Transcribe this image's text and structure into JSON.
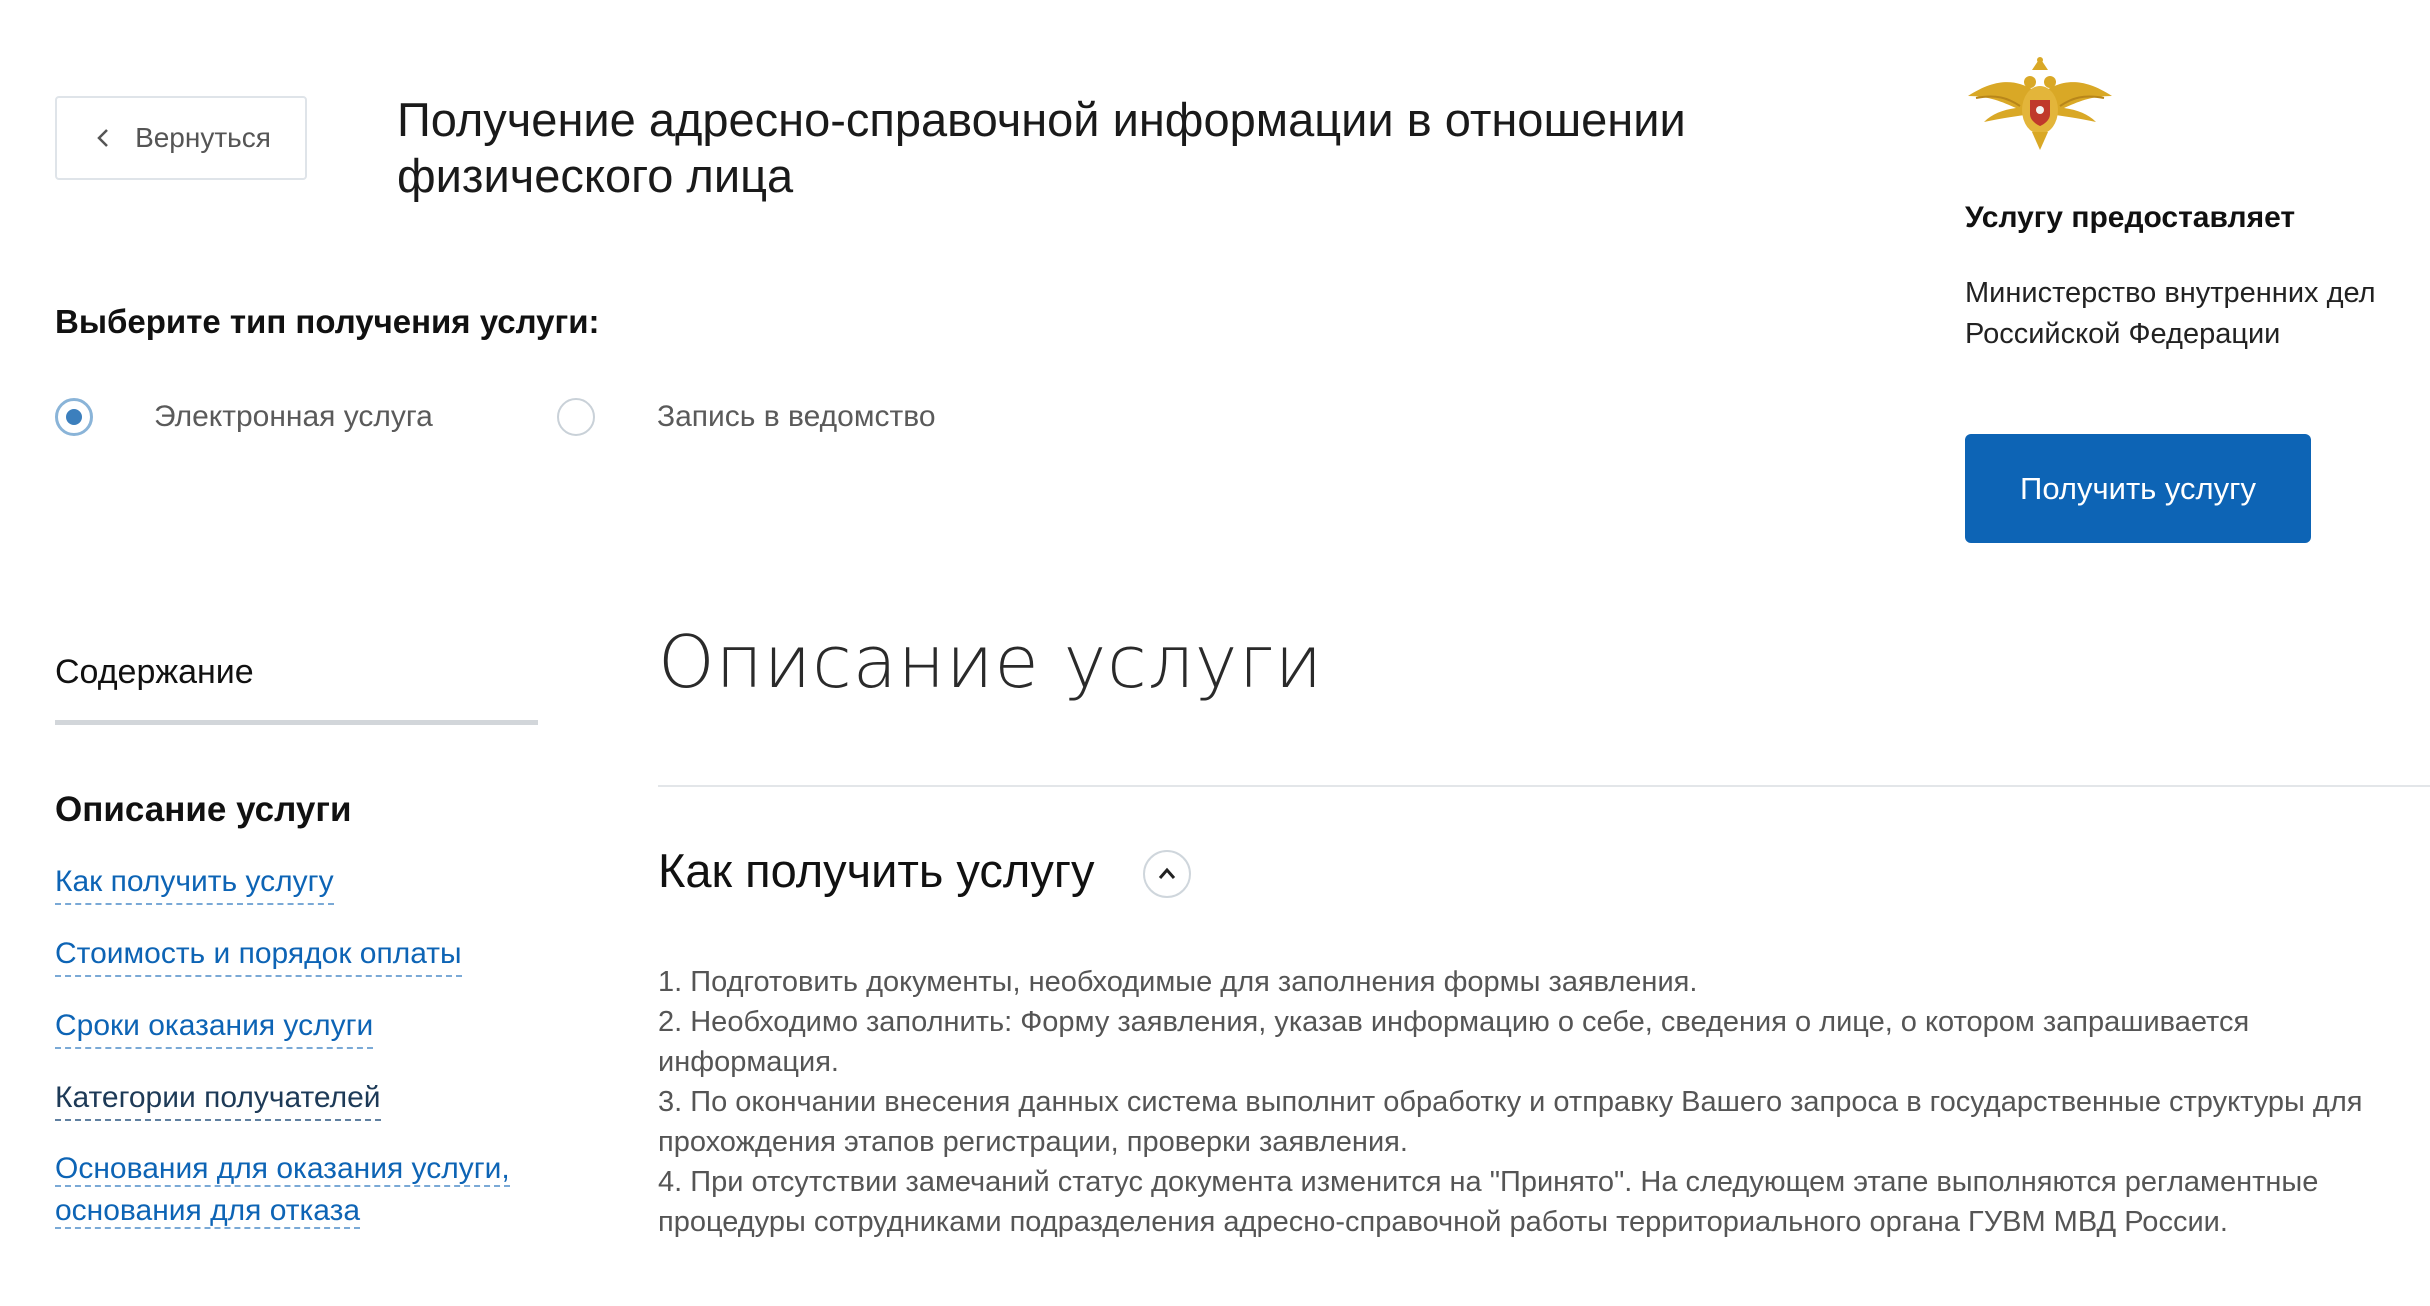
{
  "header": {
    "back_label": "Вернуться",
    "title": "Получение адресно-справочной информации в отношении физического лица"
  },
  "service_type": {
    "label": "Выберите тип получения услуги:",
    "options": [
      {
        "label": "Электронная услуга",
        "selected": true
      },
      {
        "label": "Запись в ведомство",
        "selected": false
      }
    ]
  },
  "provider": {
    "emblem_icon": "eagle-emblem-icon",
    "label": "Услугу предоставляет",
    "name": "Министерство внутренних дел Российской Федерации",
    "action_label": "Получить услугу",
    "action_color": "#0d64b5"
  },
  "toc": {
    "title": "Содержание",
    "current": "Описание услуги",
    "links": [
      "Как получить услугу",
      "Стоимость и порядок оплаты",
      "Сроки оказания услуги",
      "Категории получателей",
      "Основания для оказания услуги, основания для отказа"
    ],
    "link_last_line1": "Основания для оказания услуги,",
    "link_last_line2": "основания для отказа"
  },
  "main": {
    "section_title": "Описание услуги",
    "subsection_title": "Как получить услугу",
    "steps": [
      "1. Подготовить документы, необходимые для заполнения формы заявления.",
      "2. Необходимо заполнить: Форму заявления, указав информацию о себе, сведения о лице, о котором запрашивается информация.",
      "3. По окончании внесения данных система выполнит обработку и отправку Вашего запроса в государственные структуры для прохождения этапов регистрации, проверки заявления.",
      "4. При отсутствии замечаний статус документа изменится на \"Принято\". На следующем этапе выполняются регламентные процедуры сотрудниками подразделения адресно-справочной работы территориального органа ГУВМ МВД России."
    ]
  }
}
